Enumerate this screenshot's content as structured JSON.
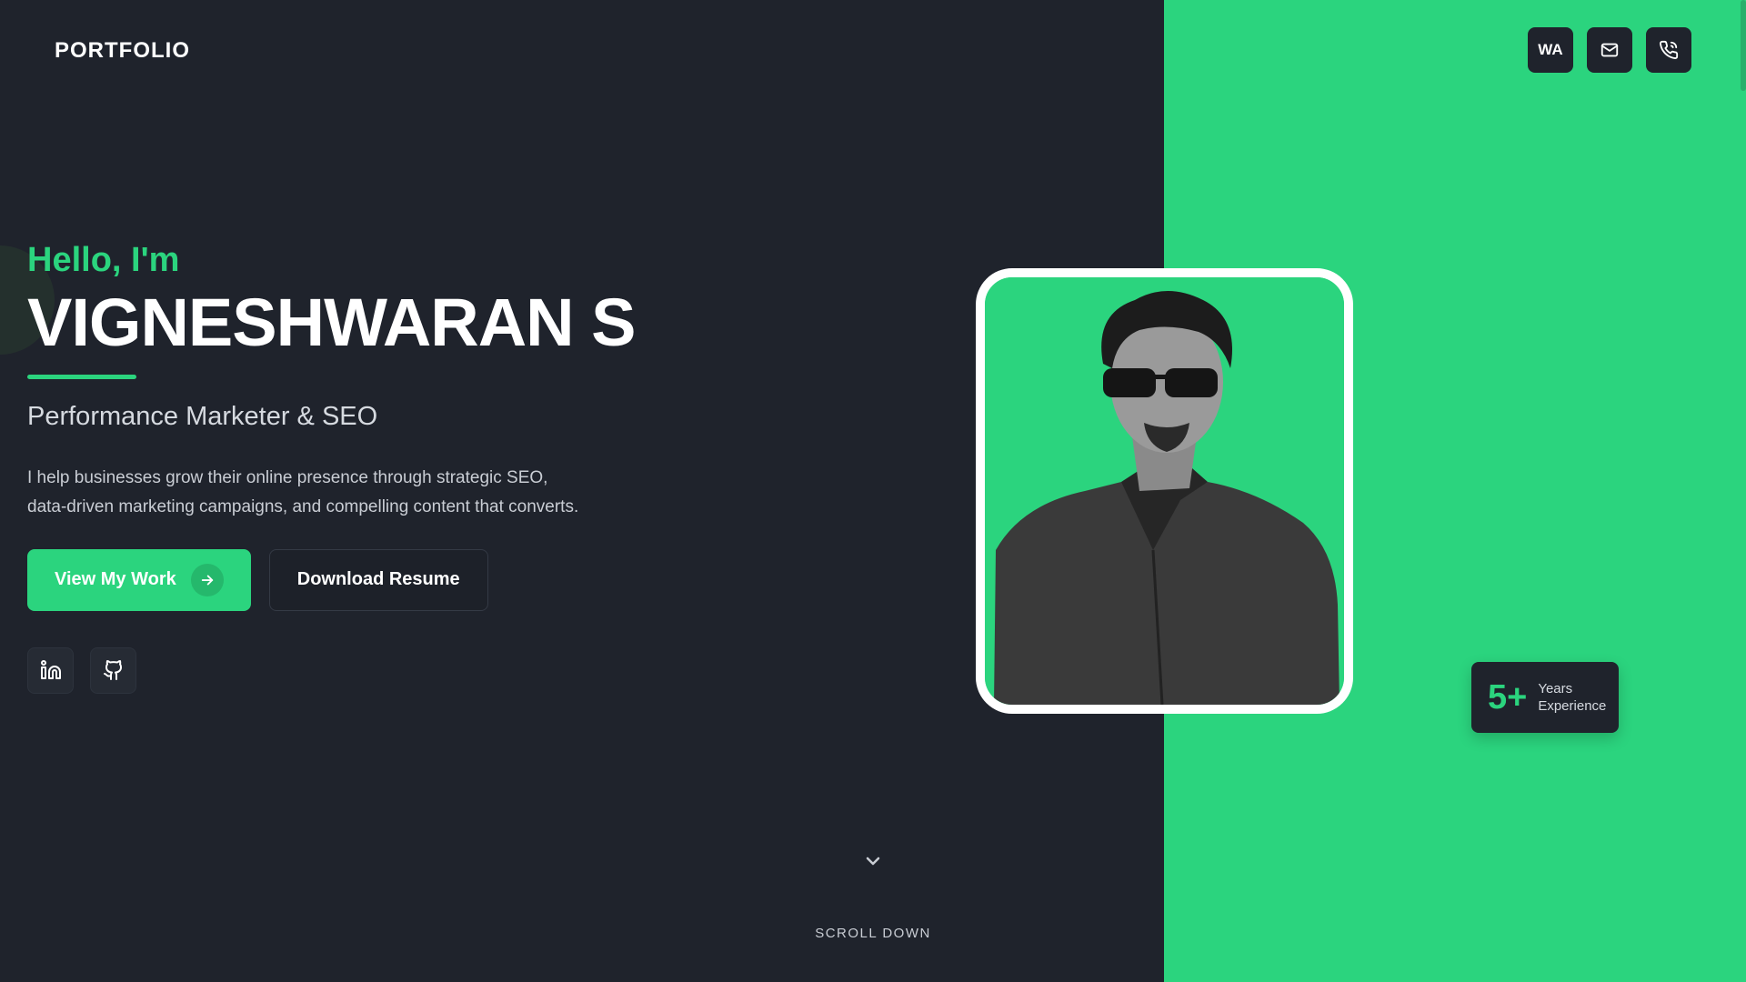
{
  "header": {
    "logo": "PORTFOLIO",
    "icons": [
      {
        "name": "whatsapp-icon",
        "label": "WA"
      },
      {
        "name": "mail-icon",
        "label": ""
      },
      {
        "name": "phone-icon",
        "label": ""
      }
    ]
  },
  "hero": {
    "greeting": "Hello, I'm",
    "name": "VIGNESHWARAN S",
    "role": "Performance Marketer & SEO",
    "description": "I help businesses grow their online presence through strategic SEO, data-driven marketing campaigns, and compelling content that converts.",
    "primary_button": "View My Work",
    "secondary_button": "Download Resume",
    "socials": [
      "linkedin-icon",
      "github-icon"
    ]
  },
  "experience": {
    "value": "5+",
    "label_line1": "Years",
    "label_line2": "Experience"
  },
  "scroll": {
    "label": "SCROLL DOWN"
  },
  "colors": {
    "accent": "#2bd47e",
    "background": "#1f232c",
    "text": "#ffffff"
  }
}
